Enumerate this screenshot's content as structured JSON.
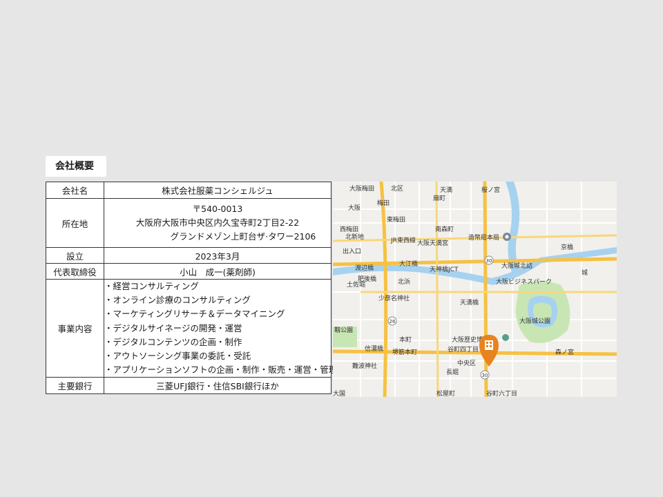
{
  "section": {
    "title": "会社概要"
  },
  "rows": {
    "company_name": {
      "label": "会社名",
      "value": "株式会社服薬コンシェルジュ"
    },
    "address": {
      "label": "所在地",
      "postal": "〒540-0013",
      "line1": "大阪府大阪市中央区内久宝寺町2丁目2-22",
      "line2": "グランドメゾン上町台ザ·タワー2106"
    },
    "founded": {
      "label": "設立",
      "value": "2023年3月"
    },
    "representative": {
      "label": "代表取締役",
      "value": "小山　成一(薬剤師)"
    },
    "business": {
      "label": "事業内容",
      "items": [
        "・経営コンサルティング",
        "・オンライン診療のコンサルティング",
        "・マーケティングリサーチ＆データマイニング",
        "・デジタルサイネージの開発・運営",
        "・デジタルコンテンツの企画・制作",
        "・アウトソーシング事業の委託・受託",
        "・アプリケーションソフトの企画・制作・販売・運営・管理"
      ]
    },
    "bank": {
      "label": "主要銀行",
      "value": "三菱UFJ銀行・住信SBI銀行ほか"
    }
  },
  "map": {
    "labels": {
      "osaka_umeda": "大阪梅田",
      "kita_ku": "北区",
      "tenma": "天満",
      "sakuranomiya": "桜ノ宮",
      "ogimachi": "扇町",
      "osaka": "大阪",
      "umeda": "梅田",
      "higashi_umeda": "東梅田",
      "minami_morimachi": "南森町",
      "nishi_umeda": "西梅田",
      "kitashinchi": "北新地",
      "jr_tozai": "JR東西線",
      "osaka_tenmangu": "大阪天満宮",
      "mint": "造幣局本局",
      "kyobashi": "京橋",
      "osaka_castle_kitazume": "大阪城北詰",
      "watanabebashi": "渡辺橋",
      "oebashi": "大江橋",
      "tenma_jct": "天神橋JCT",
      "osaka_business_park": "大阪ビジネスパーク",
      "higobashi": "肥後橋",
      "yodoyabashi": "淀屋橋",
      "kitahama": "北浜",
      "tosabori": "土佐堀",
      "sukunahikona": "少彦名神社",
      "temmabashi": "天満橋",
      "osaka_castle_park": "大阪城公園",
      "osakajokoen": "大阪城公園",
      "utsubo_park": "靱公園",
      "honmachi": "本町",
      "sakaisuji_honmachi": "堺筋本町",
      "osaka_museum": "大阪歴史博物館",
      "tanimachi4": "谷町四丁目",
      "morinomiya": "森ノ宮",
      "chuo_ku": "中央区",
      "nanba_shrine": "難波神社",
      "shinsaibashi": "信濃橋",
      "nagahori": "長堀",
      "tanimachi6": "谷町六丁目",
      "matsuyamachi": "松屋町",
      "daikoku": "大国",
      "castle": "城",
      "route_30": "30",
      "route_26": "26",
      "deiriguchi": "出入口"
    }
  },
  "colors": {
    "background": "#e6e6e6",
    "table_border": "#333333",
    "marker": "#e8831e",
    "water": "#a6d2f0",
    "park": "#c8e6b4",
    "highway": "#f6c143"
  }
}
